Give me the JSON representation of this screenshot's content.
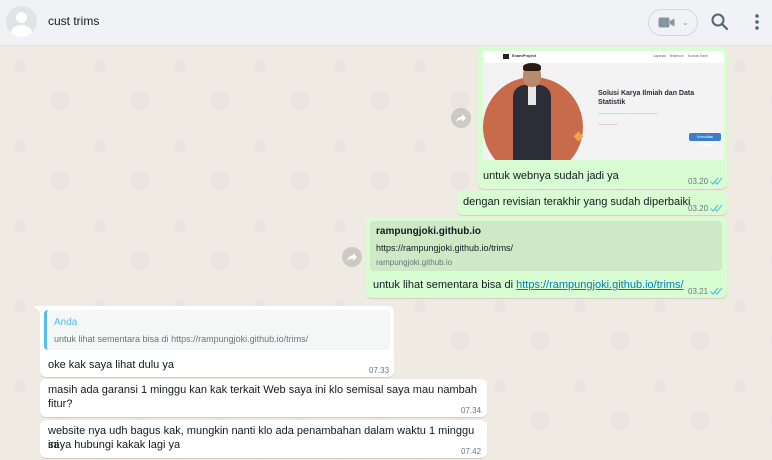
{
  "header": {
    "chat_name": "cust trims",
    "icons": [
      "avatar-icon",
      "video-icon",
      "search-icon",
      "menu-icon"
    ]
  },
  "messages": {
    "m1": {
      "image": {
        "logo_text": "ExamProject",
        "nav_links": [
          "Layanan",
          "Testimoni",
          "Kontak Kami"
        ],
        "title": "Solusi Karya Ilmiah dan Data Statistik",
        "button_text": "Konsultasi Sekarang"
      },
      "text": "untuk webnya sudah jadi ya",
      "time": "03.20"
    },
    "m2": {
      "text": "dengan revisian terakhir yang sudah diperbaiki",
      "time": "03.20"
    },
    "m3": {
      "link_preview": {
        "title": "rampungjoki.github.io",
        "url": "https://rampungjoki.github.io/trims/",
        "domain": "rampungjoki.github.io"
      },
      "text_prefix": "untuk lihat sementara bisa di ",
      "link": "https://rampungjoki.github.io/trims/",
      "time": "03.21"
    },
    "m4": {
      "quote_author": "Anda",
      "quote_text": "untuk lihat sementara bisa di https://rampungjoki.github.io/trims/",
      "text": "oke kak saya lihat dulu ya",
      "time": "07.33"
    },
    "m5": {
      "line1": "masih ada garansi 1 minggu kan kak terkait Web saya ini klo semisal saya mau nambah",
      "line2": "fitur?",
      "time": "07.34"
    },
    "m6": {
      "line1": "website nya udh bagus kak, mungkin nanti klo ada penambahan dalam waktu 1 minggu ini",
      "line2": "saya hubungi kakak lagi ya",
      "time": "07.42"
    }
  },
  "colors": {
    "outgoing_bubble": "#d9fdd3",
    "incoming_bubble": "#ffffff",
    "read_ticks": "#53bdeb",
    "link": "#027eb5"
  }
}
